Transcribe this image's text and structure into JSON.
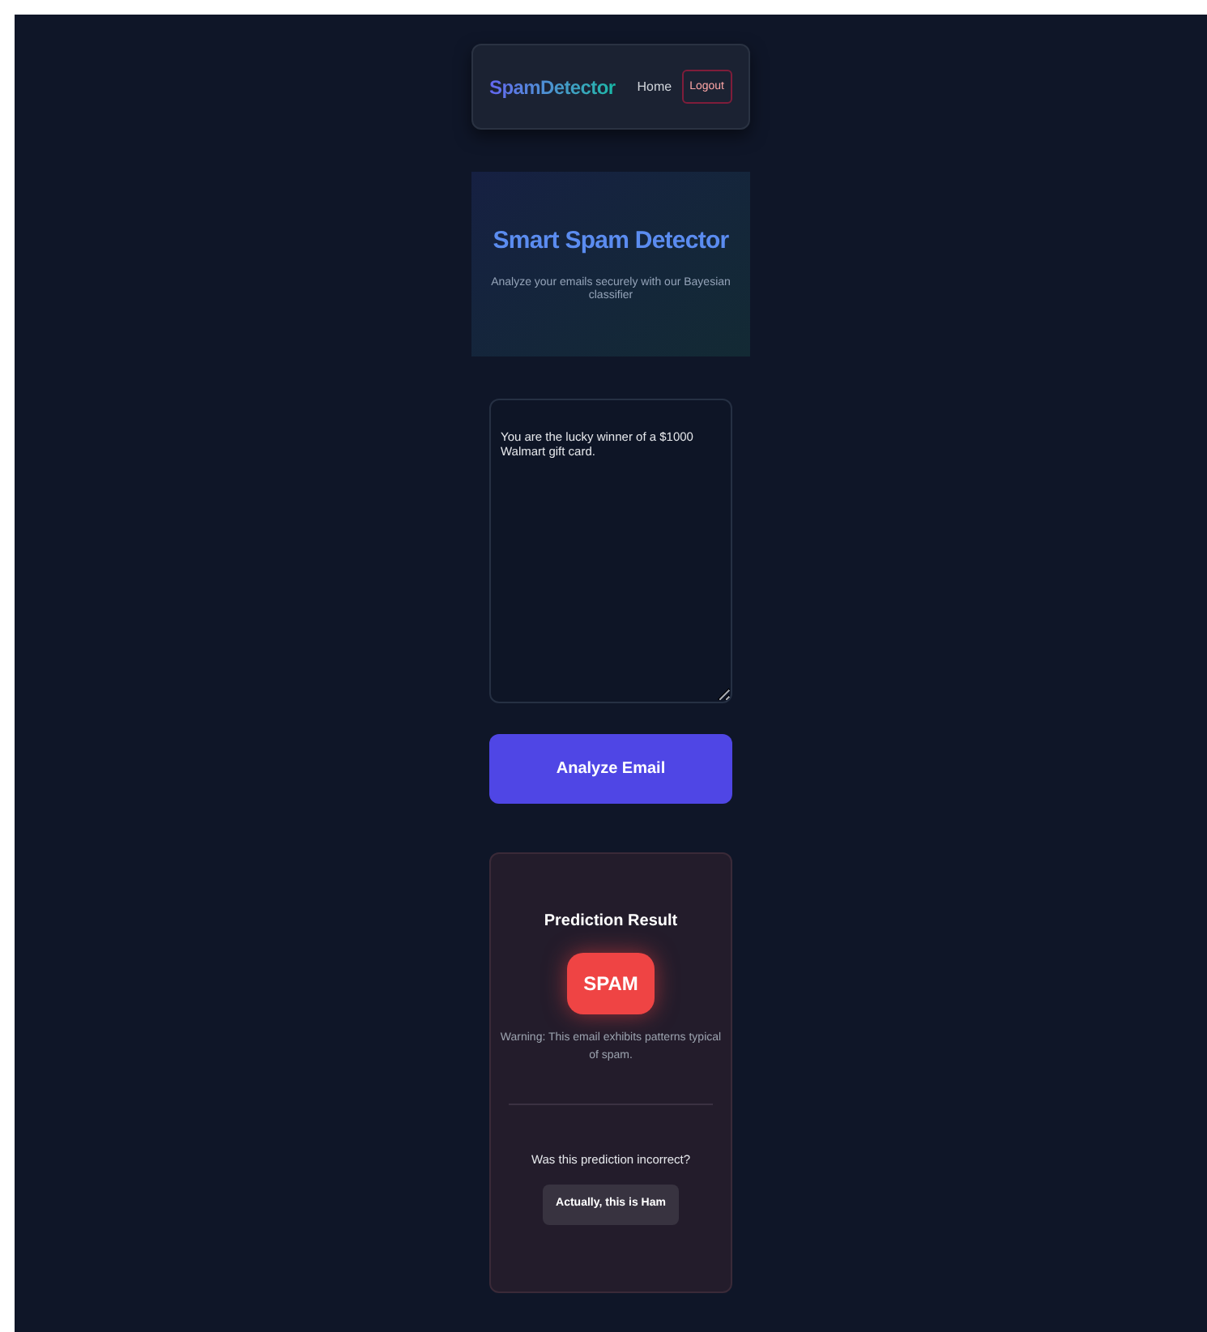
{
  "navbar": {
    "brand": "SpamDetector",
    "links": [
      {
        "label": "Home",
        "kind": "link"
      },
      {
        "label": "Logout",
        "kind": "outlined"
      }
    ]
  },
  "hero": {
    "title": "Smart Spam Detector",
    "subtitle": "Analyze your emails securely with our Bayesian classifier"
  },
  "email_input": {
    "value": "You are the lucky winner of a $1000 Walmart gift card."
  },
  "analyze_button": "Analyze Email",
  "result": {
    "title": "Prediction Result",
    "kind": "spam",
    "label": "SPAM",
    "message": "Warning: This email exhibits patterns typical of spam.",
    "feedback_question": "Was this prediction incorrect?",
    "feedback_button": "Actually, this is Ham"
  }
}
